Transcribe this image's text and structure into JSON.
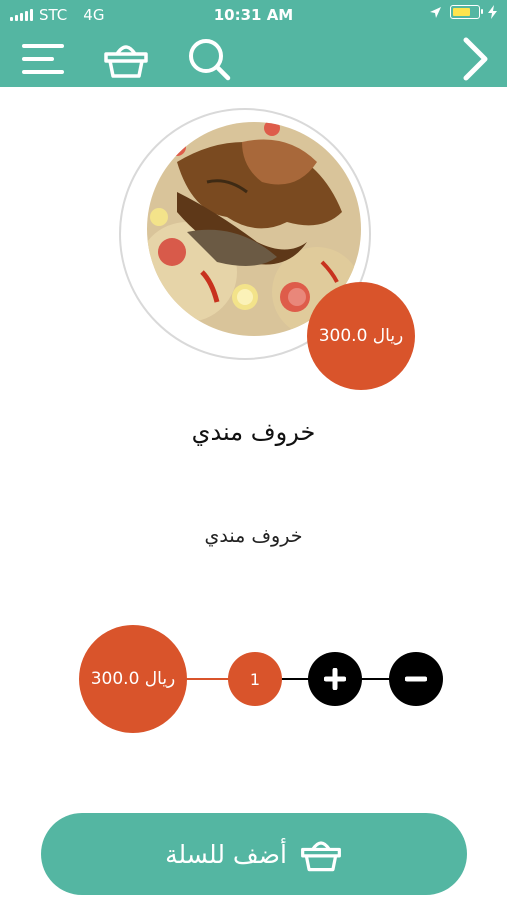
{
  "status_bar": {
    "carrier": "STC",
    "network": "4G",
    "time": "10:31 AM"
  },
  "nav": {
    "icons": [
      "menu-icon",
      "basket-icon",
      "search-icon",
      "chevron-right-icon"
    ]
  },
  "product": {
    "name": "خروف مندي",
    "description": "خروف مندي",
    "price": "300.0 ريال"
  },
  "quantity": {
    "value": "1",
    "total": "300.0 ريال"
  },
  "cart_button": {
    "label": "أضف للسلة"
  },
  "colors": {
    "teal": "#54b6a2",
    "accent": "#d9542b"
  }
}
